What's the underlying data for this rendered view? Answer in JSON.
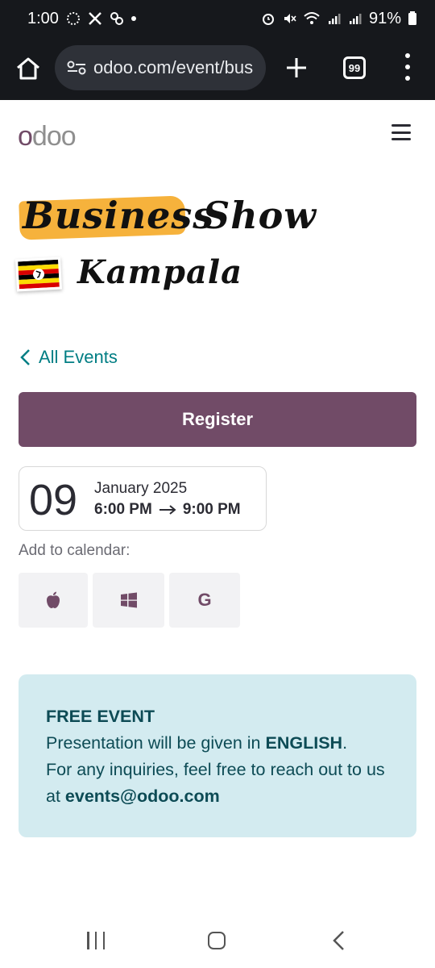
{
  "status_bar": {
    "time": "1:00",
    "battery": "91%"
  },
  "browser": {
    "url": "odoo.com/event/bus",
    "tab_count": "99"
  },
  "site": {
    "logo_first": "o",
    "logo_rest": "doo"
  },
  "hero": {
    "word1": "Business",
    "word2": "Show",
    "word3": "Kampala"
  },
  "nav": {
    "back_link": "All Events"
  },
  "register_label": "Register",
  "date": {
    "day": "09",
    "month_year": "January 2025",
    "start_time": "6:00 PM",
    "end_time": "9:00 PM"
  },
  "calendar": {
    "label": "Add to calendar:",
    "google_letter": "G"
  },
  "info": {
    "title": "FREE EVENT",
    "line_prefix": "Presentation will be given in ",
    "language": "ENGLISH",
    "line_suffix": ".",
    "inquiry": "For any inquiries, feel free to reach out to us at ",
    "email": "events@odoo.com"
  },
  "colors": {
    "brand": "#714b67",
    "link": "#017e84",
    "highlight": "#f6b23c",
    "info_bg": "#d3ebf0"
  }
}
